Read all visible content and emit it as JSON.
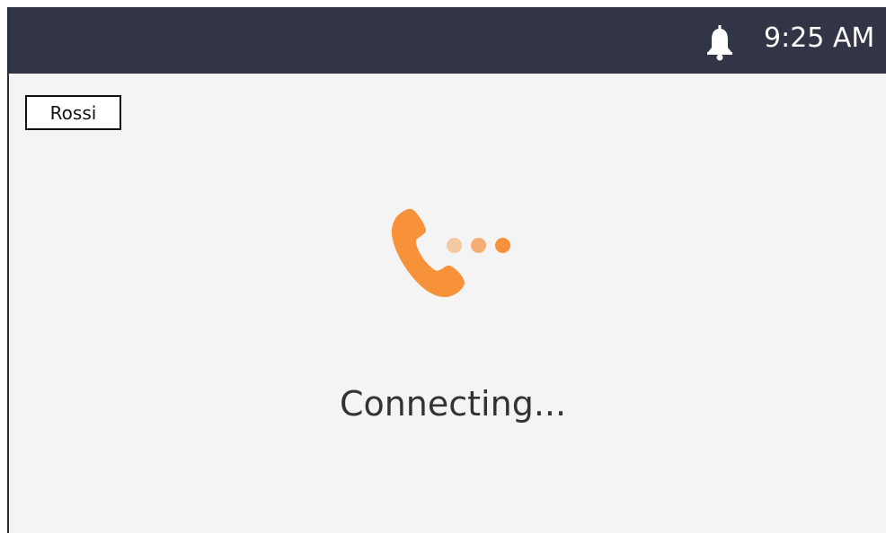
{
  "status_bar": {
    "time": "9:25 AM",
    "notification_icon": "bell-icon"
  },
  "name_tag": {
    "label": "Rossi"
  },
  "call": {
    "icon": "phone-icon",
    "status": "Connecting...",
    "accent_color": "#f7923a",
    "dot_colors": [
      "#f2c9a0",
      "#f6ad72",
      "#f7923a"
    ]
  }
}
